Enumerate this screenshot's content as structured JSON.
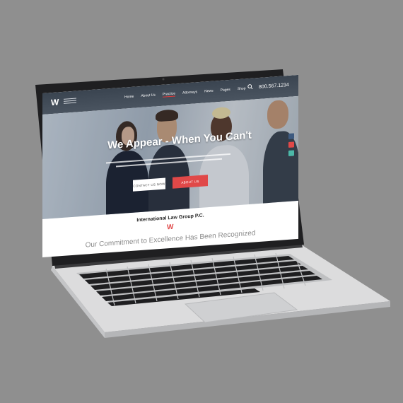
{
  "site": {
    "logo_letter": "W",
    "nav": {
      "items": [
        "Home",
        "About Us",
        "Practice",
        "Attorneys",
        "News",
        "Pages",
        "Shop"
      ],
      "active_index": 2,
      "phone": "800.567.1234"
    },
    "hero": {
      "title": "We Appear - When You Can't",
      "buttons": [
        "CONTACT US NOW",
        "ABOUT US"
      ]
    },
    "section": {
      "org_name": "International Law Group P.C.",
      "tagline": "Our Commitment to Excellence Has Been Recognized"
    }
  },
  "colors": {
    "background": "#8f8f8f",
    "accent": "#e04848",
    "nav": "#3a4450"
  }
}
